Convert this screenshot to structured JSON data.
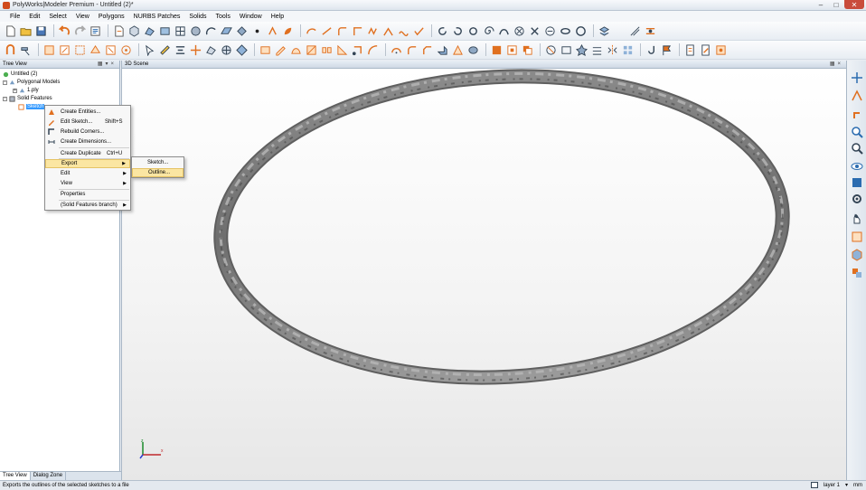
{
  "window": {
    "title": "PolyWorks|Modeler Premium - Untitled (2)*"
  },
  "menubar": {
    "items": [
      "File",
      "Edit",
      "Select",
      "View",
      "Polygons",
      "NURBS Patches",
      "Solids",
      "Tools",
      "Window",
      "Help"
    ]
  },
  "tree_panel": {
    "title": "Tree View",
    "nodes": {
      "root": "Untitled (2)",
      "polygonal": "Polygonal Models",
      "ply": "1.ply",
      "solid": "Solid Features",
      "sketch": "Sketch"
    }
  },
  "scene_panel": {
    "title": "3D Scene"
  },
  "context_menu": {
    "create_entities": "Create Entities...",
    "edit_sketch": "Edit Sketch...",
    "edit_sketch_shortcut": "Shift+S",
    "rebuild_corners": "Rebuild Corners...",
    "create_dimensions": "Create Dimensions...",
    "create_duplicate": "Create Duplicate",
    "create_duplicate_shortcut": "Ctrl+U",
    "export": "Export",
    "edit": "Edit",
    "view": "View",
    "properties": "Properties",
    "branch": "(Solid Features branch)"
  },
  "export_submenu": {
    "sketch": "Sketch...",
    "outline": "Outline..."
  },
  "bottom_tabs": [
    "Tree View",
    "Dialog Zone"
  ],
  "statusbar": {
    "message": "Exports the outlines of the selected sketches to a file",
    "layer": "layer 1",
    "units": "mm"
  },
  "colors": {
    "accent": "#3399ff",
    "highlight": "#fbe6a2",
    "icon_orange": "#e07020",
    "icon_blue": "#2b6cb0"
  }
}
